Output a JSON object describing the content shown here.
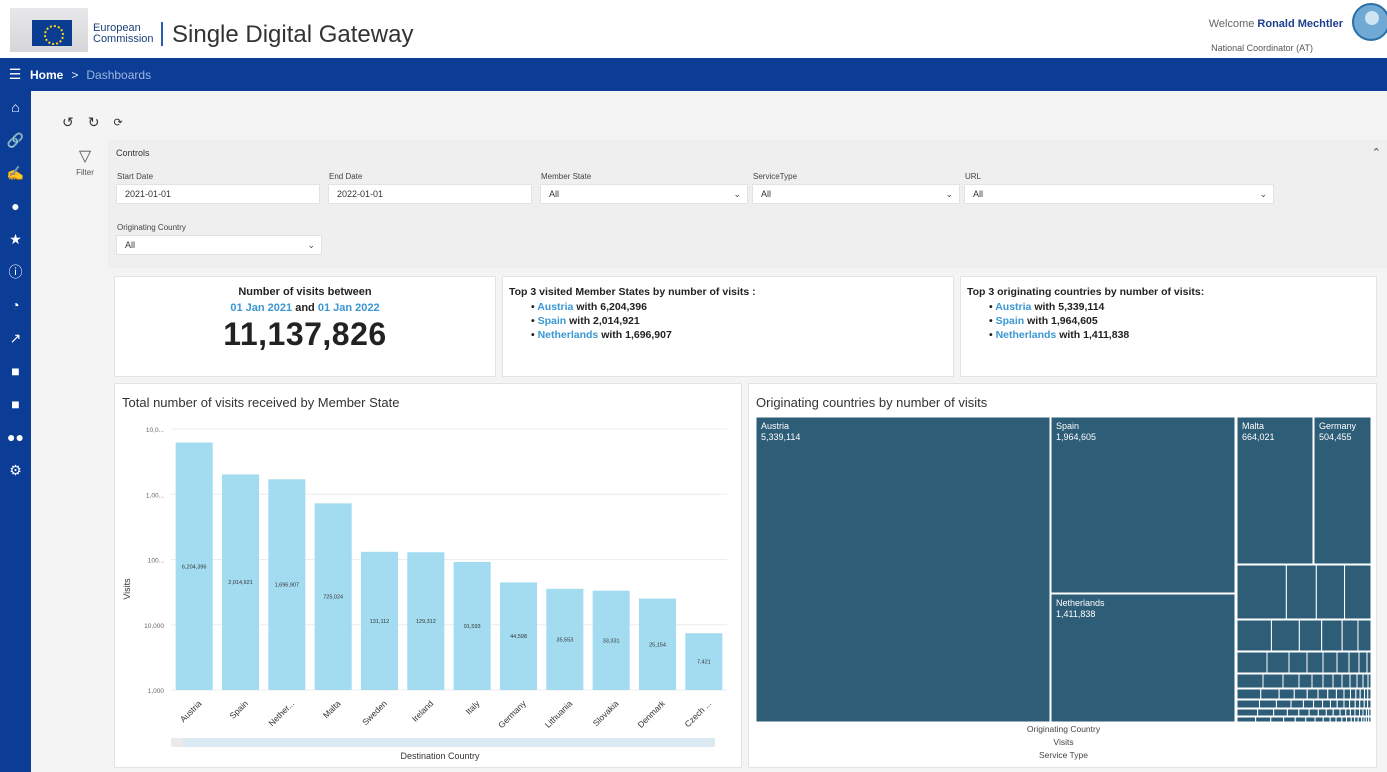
{
  "header": {
    "org_line1": "European",
    "org_line2": "Commission",
    "app_title": "Single Digital Gateway",
    "welcome_prefix": "Welcome ",
    "user_name": "Ronald Mechtler",
    "user_role": "National Coordinator (AT)"
  },
  "breadcrumb": {
    "home": "Home",
    "separator": ">",
    "current": "Dashboards"
  },
  "sidebar": {
    "icons": [
      "home-icon",
      "link-icon",
      "handshake-icon",
      "comments-icon",
      "star-icon",
      "info-icon",
      "pie-chart-icon",
      "line-chart-icon",
      "document-icon",
      "document-icon",
      "users-icon",
      "settings-icon"
    ]
  },
  "filter": {
    "label": "Filter"
  },
  "controls": {
    "title": "Controls",
    "start_date": {
      "label": "Start Date",
      "value": "2021-01-01"
    },
    "end_date": {
      "label": "End Date",
      "value": "2022-01-01"
    },
    "member_state": {
      "label": "Member State",
      "value": "All"
    },
    "service_type": {
      "label": "ServiceType",
      "value": "All"
    },
    "url": {
      "label": "URL",
      "value": "All"
    },
    "originating_country": {
      "label": "Originating Country",
      "value": "All"
    }
  },
  "kpi_visits": {
    "line1": "Number of visits between",
    "from": "01 Jan 2021",
    "and": "and",
    "to": "01 Jan 2022",
    "total": "11,137,826"
  },
  "kpi_member_states": {
    "title": "Top 3 visited Member States by number of visits :",
    "items": [
      {
        "country": "Austria",
        "text": "with 6,204,396"
      },
      {
        "country": "Spain",
        "text": "with 2,014,921"
      },
      {
        "country": "Netherlands",
        "text": "with 1,696,907"
      }
    ]
  },
  "kpi_origin": {
    "title": "Top 3 originating countries by number of visits:",
    "items": [
      {
        "country": "Austria",
        "text": "with 5,339,114"
      },
      {
        "country": "Spain",
        "text": "with 1,964,605"
      },
      {
        "country": "Netherlands",
        "text": "with 1,411,838"
      }
    ]
  },
  "chart_data": [
    {
      "type": "bar",
      "title": "Total number of visits received by Member State",
      "xlabel": "Destination Country",
      "ylabel": "Visits",
      "scale": "log",
      "y_ticks": [
        "1,000",
        "10,000",
        "100...",
        "1,00...",
        "10,0..."
      ],
      "ylim": [
        1000,
        10000000
      ],
      "categories": [
        "Austria",
        "Spain",
        "Nether...",
        "Malta",
        "Sweden",
        "Ireland",
        "Italy",
        "Germany",
        "Lithuania",
        "Slovakia",
        "Denmark",
        "Czech ..."
      ],
      "values": [
        6204396,
        2014921,
        1696907,
        725024,
        131112,
        129312,
        91593,
        44598,
        35553,
        33331,
        25154,
        7421
      ],
      "value_labels": [
        "6,204,396",
        "2,014,921",
        "1,696,907",
        "725,024",
        "131,112",
        "129,312",
        "91,593",
        "44,598",
        "35,553",
        "33,331",
        "25,154",
        "7,421"
      ],
      "color": "#a3dcf1"
    },
    {
      "type": "treemap",
      "title": "Originating countries by number of visits",
      "labels": [
        "Austria",
        "Spain",
        "Netherlands",
        "Malta",
        "Germany"
      ],
      "values": [
        5339114,
        1964605,
        1411838,
        664021,
        504455
      ],
      "value_labels": [
        "5,339,114",
        "1,964,605",
        "1,411,838",
        "664,021",
        "504,455"
      ],
      "footer": [
        "Originating Country",
        "Visits",
        "Service Type"
      ],
      "color": "#2d5d77"
    }
  ]
}
